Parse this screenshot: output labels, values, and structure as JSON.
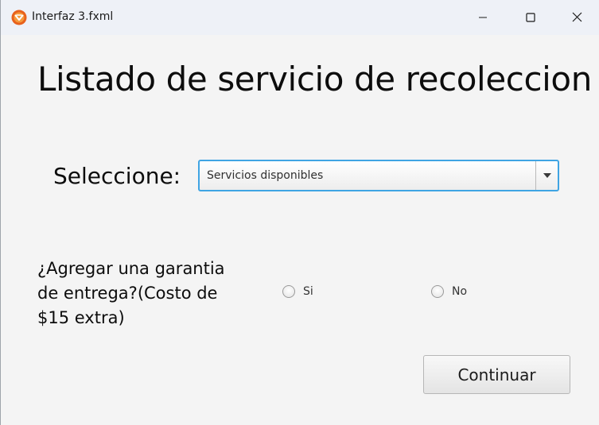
{
  "window": {
    "title": "Interfaz 3.fxml"
  },
  "main": {
    "heading": "Listado de servicio de recoleccion",
    "select_label": "Seleccione:",
    "combo_value": "Servicios disponibles",
    "question": "¿Agregar una garantia de entrega?(Costo de $15 extra)",
    "radio_options": [
      {
        "label": "Si",
        "selected": false
      },
      {
        "label": "No",
        "selected": false
      }
    ],
    "continue_label": "Continuar"
  },
  "colors": {
    "accent": "#3fa4e3",
    "background": "#f4f4f4",
    "titlebar": "#eef1f7"
  }
}
